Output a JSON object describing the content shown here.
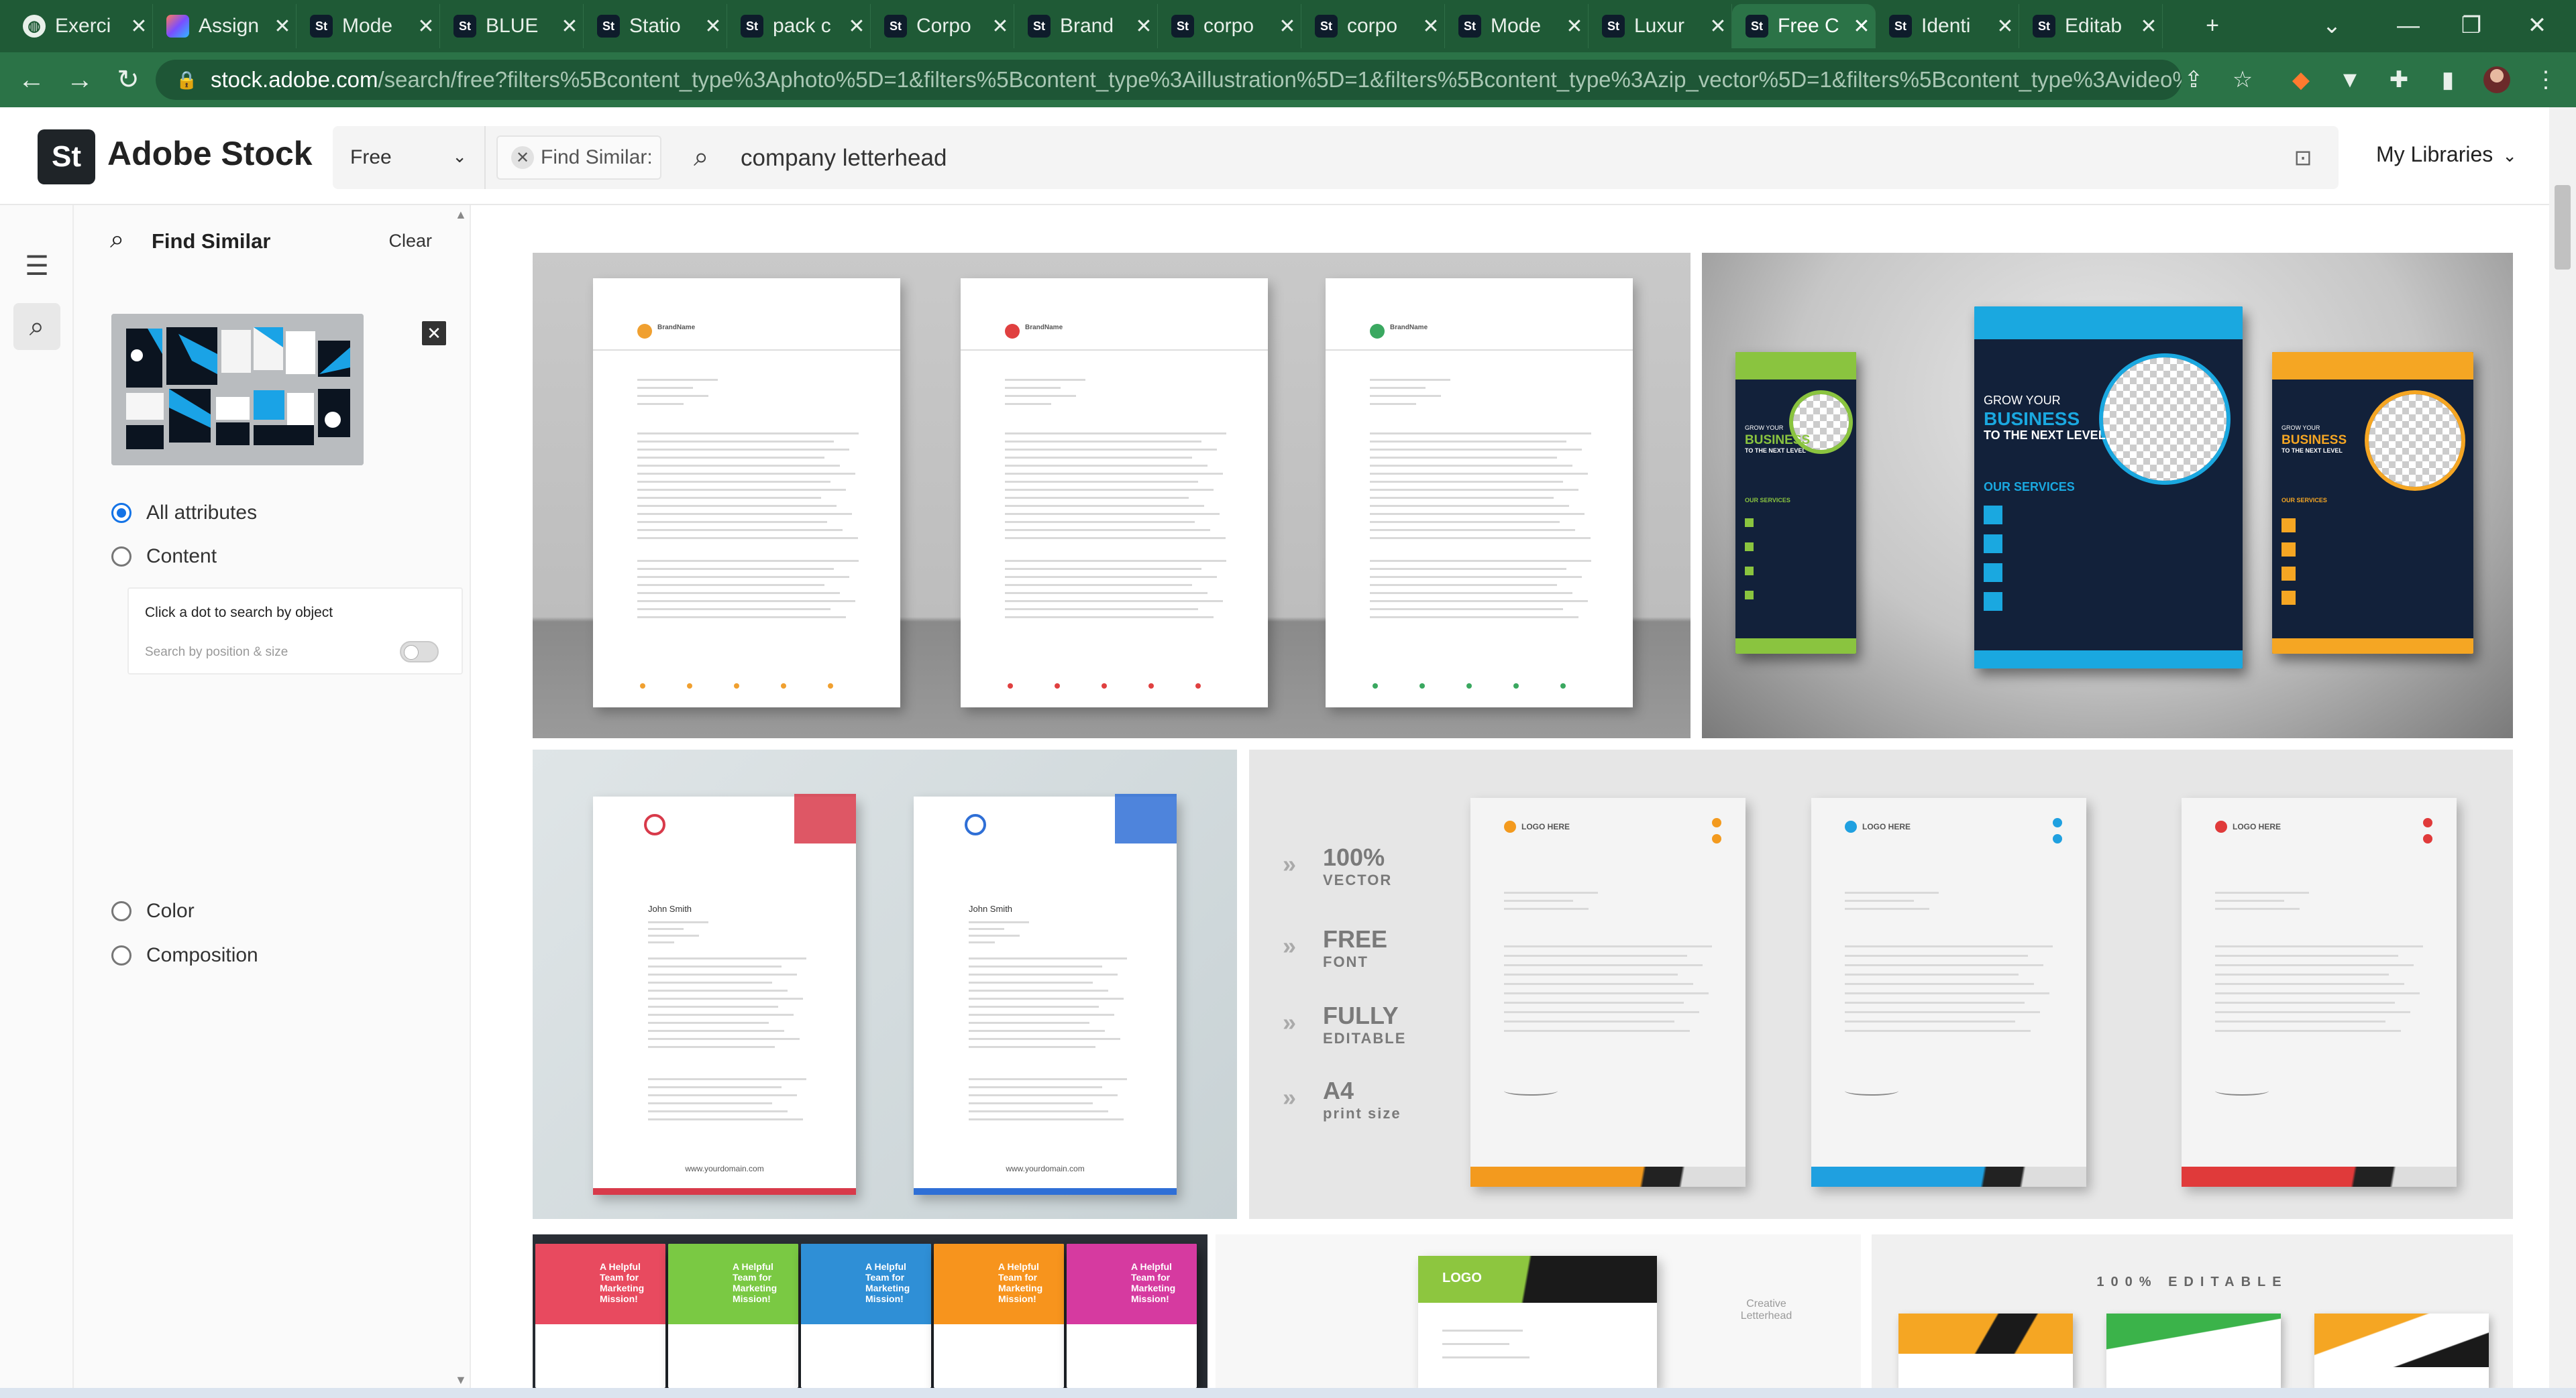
{
  "browser": {
    "tabs": [
      {
        "label": "Exerci",
        "favicon": "globe-icon"
      },
      {
        "label": "Assign",
        "favicon": "gradient-app-icon"
      },
      {
        "label": "Mode",
        "favicon": "adobe-stock-icon"
      },
      {
        "label": "BLUE",
        "favicon": "adobe-stock-icon"
      },
      {
        "label": "Statio",
        "favicon": "adobe-stock-icon"
      },
      {
        "label": "pack c",
        "favicon": "adobe-stock-icon"
      },
      {
        "label": "Corpo",
        "favicon": "adobe-stock-icon"
      },
      {
        "label": "Brand",
        "favicon": "adobe-stock-icon"
      },
      {
        "label": "corpo",
        "favicon": "adobe-stock-icon"
      },
      {
        "label": "corpo",
        "favicon": "adobe-stock-icon"
      },
      {
        "label": "Mode",
        "favicon": "adobe-stock-icon"
      },
      {
        "label": "Luxur",
        "favicon": "adobe-stock-icon"
      },
      {
        "label": "Free C",
        "favicon": "adobe-stock-icon",
        "active": true
      },
      {
        "label": "Identi",
        "favicon": "adobe-stock-icon"
      },
      {
        "label": "Editab",
        "favicon": "adobe-stock-icon"
      }
    ],
    "favicon_text": "St",
    "close_glyph": "✕",
    "new_tab_glyph": "+",
    "url_domain": "stock.adobe.com",
    "url_path": "/search/free?filters%5Bcontent_type%3Aphoto%5D=1&filters%5Bcontent_type%3Aillustration%5D=1&filters%5Bcontent_type%3Azip_vector%5D=1&filters%5Bcontent_type%3Avideo%5D=0..."
  },
  "stock": {
    "logo_text": "St",
    "brand": "Adobe Stock",
    "license_filter": "Free",
    "find_similar_chip": "Find Similar:",
    "search_query": "company letterhead",
    "my_libraries": "My Libraries"
  },
  "panel": {
    "title": "Find Similar",
    "clear": "Clear",
    "options": [
      {
        "label": "All attributes",
        "selected": true
      },
      {
        "label": "Content",
        "selected": false
      },
      {
        "label": "Color",
        "selected": false
      },
      {
        "label": "Composition",
        "selected": false
      }
    ],
    "object_search_title": "Click a dot to search by object",
    "object_search_sub": "Search by position & size"
  },
  "results": {
    "card1": {
      "sheet_brand": "BrandName",
      "accent_colors": [
        "#f0a030",
        "#e04040",
        "#3aa860"
      ]
    },
    "card2": {
      "flyer_title_small": "GROW YOUR",
      "flyer_title_big": "BUSINESS",
      "flyer_title_tail": "TO THE NEXT LEVEL",
      "flyer_services": "OUR SERVICES",
      "colors": [
        "#8ac43f",
        "#1aa8e0",
        "#f5a623"
      ]
    },
    "card3": {
      "name": "John Smith",
      "site": "www.yourdomain.com",
      "colors": [
        "#d83a4a",
        "#2f6fd6"
      ]
    },
    "card4": {
      "features": [
        {
          "big": "100%",
          "small": "VECTOR"
        },
        {
          "big": "FREE",
          "small": "FONT"
        },
        {
          "big": "FULLY",
          "small": "EDITABLE"
        },
        {
          "big": "A4",
          "small": "print size"
        }
      ],
      "logo_text": "LOGO HERE",
      "colors": [
        "#f39a1e",
        "#1fa0e0",
        "#e03a3a"
      ]
    },
    "card5": {
      "headline": "A Helpful Team for Marketing Mission!",
      "colors": [
        "#e84a5f",
        "#7ac943",
        "#2f8fd6",
        "#f7941d",
        "#d63aa0"
      ]
    },
    "card6": {
      "logo_text": "LOGO",
      "caption_line1": "Creative",
      "caption_line2": "Letterhead"
    },
    "card7": {
      "banner": "100% EDITABLE"
    }
  }
}
